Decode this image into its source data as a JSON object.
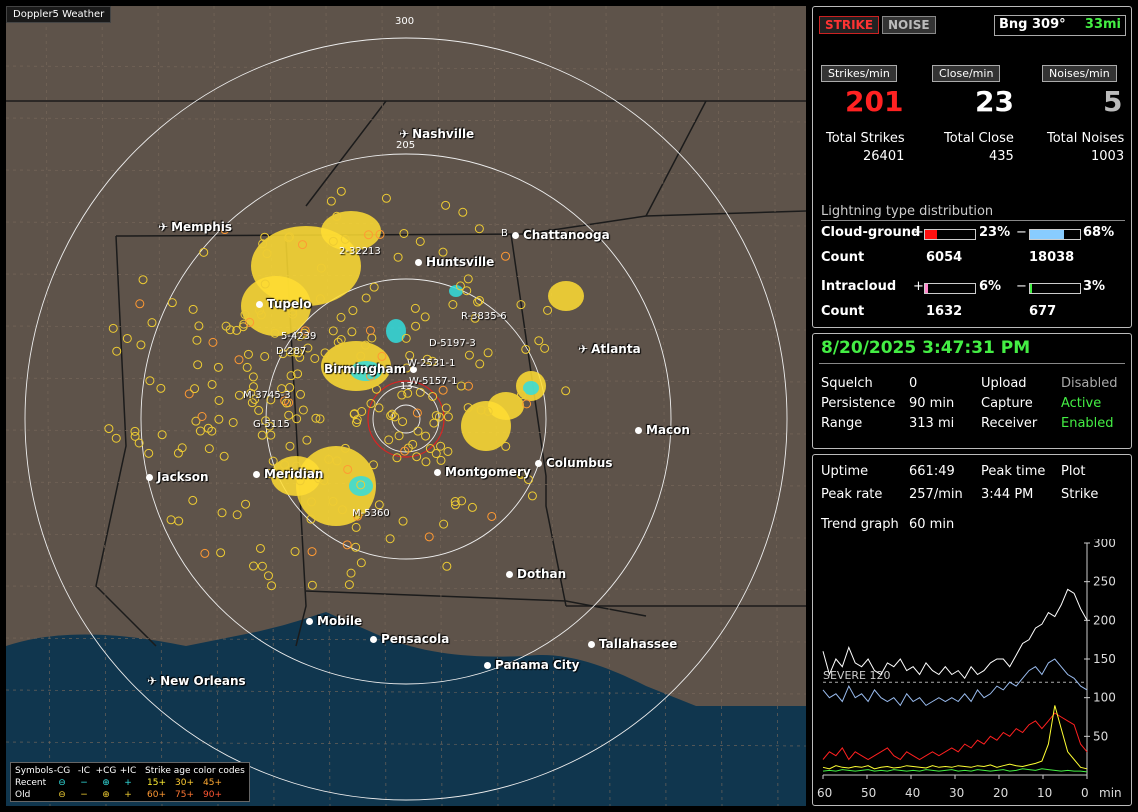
{
  "map": {
    "title": "Doppler5 Weather",
    "ring_labels": [
      "300",
      "205",
      "13"
    ],
    "cities": [
      {
        "name": "Nashville",
        "type": "airport"
      },
      {
        "name": "Memphis",
        "type": "airport"
      },
      {
        "name": "Chattanooga",
        "type": "dot"
      },
      {
        "name": "Huntsville",
        "type": "dot"
      },
      {
        "name": "Tupelo",
        "type": "dot"
      },
      {
        "name": "Atlanta",
        "type": "airport"
      },
      {
        "name": "Birmingham",
        "type": "dot"
      },
      {
        "name": "Macon",
        "type": "dot"
      },
      {
        "name": "Jackson",
        "type": "dot"
      },
      {
        "name": "Meridian",
        "type": "dot"
      },
      {
        "name": "Montgomery",
        "type": "dot"
      },
      {
        "name": "Columbus",
        "type": "dot"
      },
      {
        "name": "Dothan",
        "type": "dot"
      },
      {
        "name": "Mobile",
        "type": "dot"
      },
      {
        "name": "Pensacola",
        "type": "dot"
      },
      {
        "name": "Tallahassee",
        "type": "dot"
      },
      {
        "name": "New Orleans",
        "type": "airport"
      },
      {
        "name": "Panama City",
        "type": "dot"
      }
    ],
    "cell_labels": [
      "2-32213",
      "R-3835-6",
      "D-5197-3",
      "W-2531-1",
      "W-5157-1",
      "M-3745-3",
      "G-5115",
      "M-5360",
      "D-287",
      "5-4239",
      "B"
    ],
    "legend": {
      "symbols_label": "Symbols",
      "cg_neg": "-CG",
      "ic_neg": "-IC",
      "cg_pos": "+CG",
      "ic_pos": "+IC",
      "age_label": "Strike age color codes",
      "recent": "Recent",
      "old": "Old",
      "recent_sym": [
        "⊖",
        "−",
        "⊕",
        "+"
      ],
      "old_sym": [
        "⊖",
        "−",
        "⊕",
        "+"
      ],
      "recent_ages": [
        "15+",
        "30+",
        "45+"
      ],
      "old_ages": [
        "60+",
        "75+",
        "90+"
      ],
      "colors": {
        "recent_minus": "#33dddd",
        "old_minus": "#eecc33"
      }
    }
  },
  "header": {
    "strike_btn": "STRIKE",
    "noise_btn": "NOISE",
    "bearing": "Bng 309°",
    "distance": "33mi"
  },
  "rates": {
    "strikes_label": "Strikes/min",
    "close_label": "Close/min",
    "noises_label": "Noises/min",
    "strikes": "201",
    "close": "23",
    "noises": "5",
    "total_strikes_label": "Total Strikes",
    "total_close_label": "Total Close",
    "total_noises_label": "Total Noises",
    "total_strikes": "26401",
    "total_close": "435",
    "total_noises": "1003"
  },
  "distribution": {
    "title": "Lightning type distribution",
    "cg_label": "Cloud-ground",
    "cg_pos_pct": "23%",
    "cg_neg_pct": "68%",
    "cg_pos_fill": 0.23,
    "cg_neg_fill": 0.68,
    "count_label": "Count",
    "cg_pos_count": "6054",
    "cg_neg_count": "18038",
    "ic_label": "Intracloud",
    "ic_pos_pct": "6%",
    "ic_neg_pct": "3%",
    "ic_pos_fill": 0.06,
    "ic_neg_fill": 0.03,
    "ic_pos_count": "1632",
    "ic_neg_count": "677",
    "plus": "+",
    "minus": "−"
  },
  "status": {
    "datetime": "8/20/2025 3:47:31 PM",
    "squelch_label": "Squelch",
    "squelch": "0",
    "upload_label": "Upload",
    "upload": "Disabled",
    "persistence_label": "Persistence",
    "persistence": "90 min",
    "capture_label": "Capture",
    "capture": "Active",
    "range_label": "Range",
    "range": "313 mi",
    "receiver_label": "Receiver",
    "receiver": "Enabled"
  },
  "trend": {
    "uptime_label": "Uptime",
    "uptime": "661:49",
    "peak_time_label": "Peak time",
    "peak_time": "3:44 PM",
    "plot_label": "Plot",
    "plot": "Strike",
    "peak_rate_label": "Peak rate",
    "peak_rate": "257/min",
    "trend_label": "Trend graph",
    "trend_window": "60 min",
    "severe_label": "SEVERE 120",
    "y_ticks": [
      "300",
      "250",
      "200",
      "150",
      "100",
      "50"
    ],
    "x_ticks": [
      "60",
      "50",
      "40",
      "30",
      "20",
      "10",
      "0"
    ],
    "x_unit": "min"
  },
  "chart_data": {
    "type": "line",
    "xlabel": "min",
    "ylim": [
      0,
      300
    ],
    "xlim": [
      60,
      0
    ],
    "threshold": 120,
    "series": [
      {
        "color": "#ffffff",
        "values": [
          160,
          130,
          150,
          140,
          165,
          145,
          140,
          150,
          135,
          130,
          145,
          140,
          150,
          135,
          140,
          130,
          145,
          135,
          130,
          140,
          130,
          135,
          125,
          140,
          130,
          135,
          145,
          150,
          150,
          140,
          155,
          170,
          175,
          190,
          195,
          210,
          205,
          220,
          240,
          235,
          215,
          200
        ]
      },
      {
        "color": "#99bbee",
        "values": [
          110,
          100,
          105,
          95,
          115,
          100,
          105,
          95,
          110,
          100,
          95,
          100,
          90,
          105,
          95,
          100,
          90,
          95,
          100,
          95,
          100,
          95,
          105,
          95,
          110,
          100,
          105,
          115,
          110,
          120,
          115,
          125,
          135,
          140,
          130,
          145,
          150,
          140,
          130,
          125,
          115,
          110
        ]
      },
      {
        "color": "#ff2020",
        "values": [
          20,
          30,
          25,
          35,
          20,
          30,
          25,
          20,
          25,
          30,
          35,
          25,
          20,
          30,
          25,
          20,
          25,
          30,
          25,
          30,
          35,
          30,
          40,
          35,
          45,
          40,
          50,
          45,
          55,
          50,
          60,
          55,
          65,
          70,
          60,
          70,
          80,
          75,
          70,
          65,
          40,
          30
        ]
      },
      {
        "color": "#ffff33",
        "values": [
          10,
          8,
          12,
          10,
          9,
          11,
          10,
          12,
          8,
          10,
          11,
          9,
          10,
          12,
          11,
          10,
          9,
          12,
          10,
          11,
          10,
          12,
          11,
          10,
          12,
          11,
          13,
          10,
          12,
          14,
          12,
          11,
          13,
          15,
          18,
          40,
          90,
          60,
          30,
          20,
          10,
          8
        ]
      },
      {
        "color": "#44ee44",
        "values": [
          5,
          6,
          5,
          7,
          6,
          5,
          6,
          7,
          5,
          6,
          5,
          7,
          6,
          5,
          6,
          5,
          7,
          6,
          5,
          6,
          7,
          5,
          6,
          5,
          7,
          6,
          5,
          6,
          7,
          5,
          6,
          8,
          7,
          6,
          8,
          7,
          6,
          5,
          6,
          5,
          5,
          4
        ]
      }
    ]
  }
}
